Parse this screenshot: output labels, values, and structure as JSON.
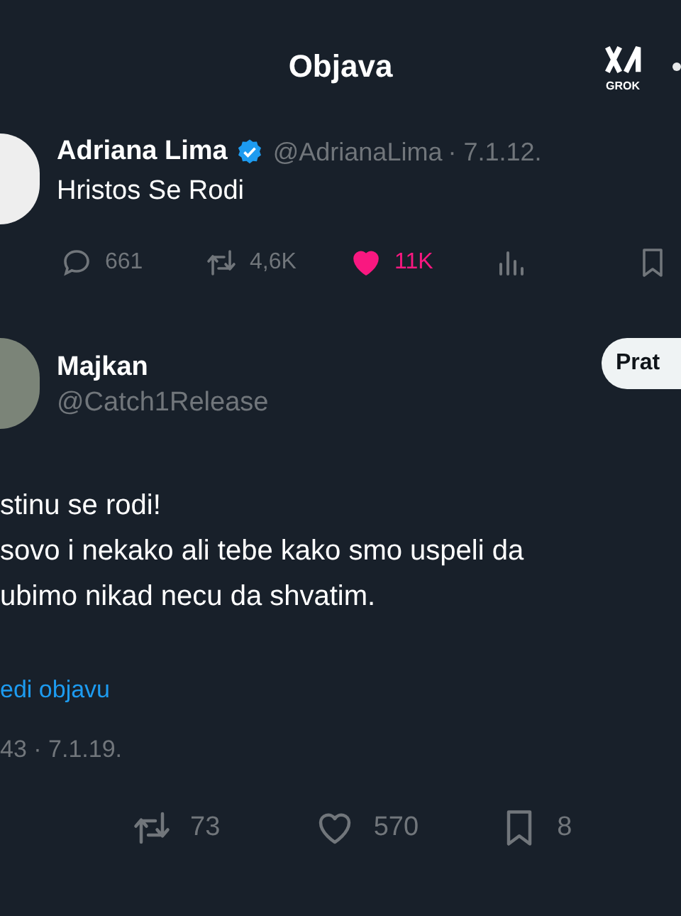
{
  "header": {
    "title": "Objava",
    "grok_label": "GROK"
  },
  "quoted_post": {
    "name": "Adriana Lima",
    "verified": true,
    "handle": "@AdrianaLima",
    "date": "· 7.1.12.",
    "text": "Hristos Se Rodi",
    "actions": [
      {
        "kind": "reply",
        "count": "661",
        "active": false
      },
      {
        "kind": "repost",
        "count": "4,6K",
        "active": false
      },
      {
        "kind": "like",
        "count": "11K",
        "active": true
      },
      {
        "kind": "views",
        "active": false
      },
      {
        "kind": "bookmark",
        "active": false
      }
    ]
  },
  "reply_post": {
    "name": "Majkan",
    "handle": "@Catch1Release",
    "follow_label": "Prat",
    "lines": [
      "stinu se rodi!",
      "sovo i nekako ali tebe kako smo uspeli da",
      "ubimo nikad necu da shvatim."
    ],
    "translate_link": "edi objavu",
    "timestamp": "43 · 7.1.19.",
    "actions": [
      {
        "kind": "repost",
        "count": "73",
        "active": false
      },
      {
        "kind": "like",
        "count": "570",
        "active": false
      },
      {
        "kind": "bookmark",
        "count": "8",
        "active": false
      }
    ]
  }
}
